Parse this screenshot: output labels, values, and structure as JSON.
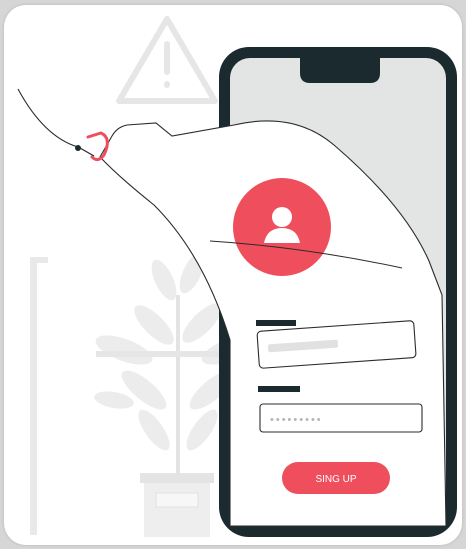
{
  "illustration": {
    "signup_button_label": "SING UP",
    "password_mask": "•••••••••",
    "colors": {
      "accent": "#ef4e5d",
      "phone_frame": "#1b2a2e",
      "background_art": "#eeeeee",
      "outline": "#2b2b2b"
    },
    "icons": [
      "warning-triangle-icon",
      "user-avatar-icon",
      "fishing-hook-icon",
      "potted-plant-illustration"
    ]
  }
}
